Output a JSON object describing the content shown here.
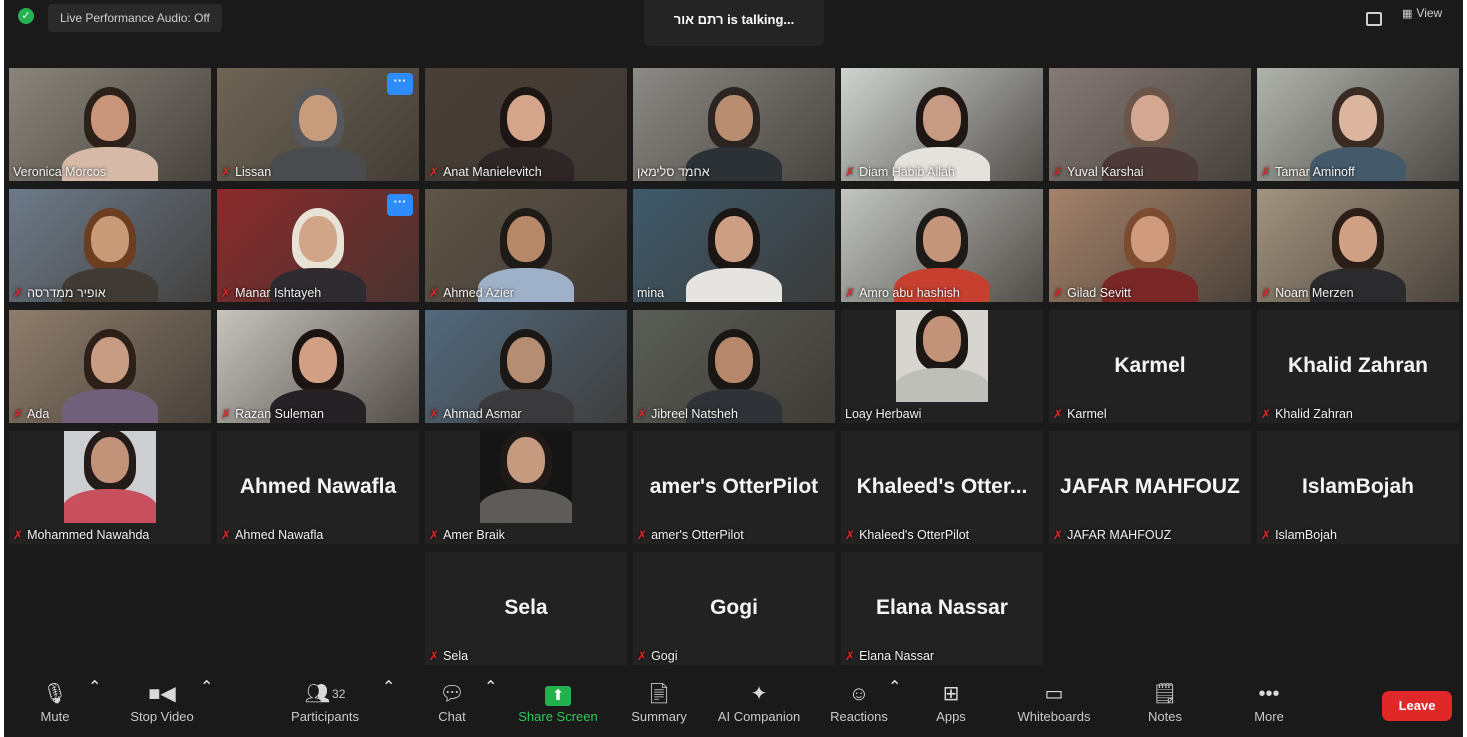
{
  "top_bar": {
    "audio_status": "Live Performance Audio: Off",
    "talking_banner": "רתם אור is talking...",
    "view_label": "View"
  },
  "participant_tiles": [
    {
      "name": "Veronica Morcos",
      "muted": false,
      "video": true,
      "bg": "#8a857c",
      "skin": "#c9957a",
      "hair": "#2b2119",
      "shirt": "#d7b9a8"
    },
    {
      "name": "Lissan",
      "muted": true,
      "video": true,
      "more": true,
      "bg": "#6e6556",
      "skin": "#c69c7d",
      "hair": "#56575a",
      "shirt": "#4a4b4f"
    },
    {
      "name": "Anat Manielevitch",
      "muted": true,
      "video": true,
      "bg": "#4a3f38",
      "skin": "#d4a48b",
      "hair": "#1c1513",
      "shirt": "#2d2526"
    },
    {
      "name": "אחמד סלימאן",
      "muted": false,
      "video": true,
      "bg": "#8c8a86",
      "skin": "#b98e70",
      "hair": "#2c2420",
      "shirt": "#2c3136"
    },
    {
      "name": "Diam Habib Allah",
      "muted": true,
      "video": true,
      "bg": "#cfd3d0",
      "skin": "#c79b83",
      "hair": "#1f1714",
      "shirt": "#e4e2dc"
    },
    {
      "name": "Yuval Karshai",
      "muted": true,
      "video": true,
      "bg": "#857a75",
      "skin": "#d3a791",
      "hair": "#6a5548",
      "shirt": "#4c3a38"
    },
    {
      "name": "Tamar Aminoff",
      "muted": true,
      "video": true,
      "bg": "#b0b3ac",
      "skin": "#dcb59f",
      "hair": "#3a2b22",
      "shirt": "#445a6a"
    },
    {
      "name": "אופיר ממדרסה",
      "muted": true,
      "video": true,
      "bg": "#6d7a89",
      "skin": "#c99a78",
      "hair": "#6b3d21",
      "shirt": "#3f3a34"
    },
    {
      "name": "Manar Ishtayeh",
      "muted": true,
      "video": true,
      "more": true,
      "bg": "#8c2a2c",
      "skin": "#d1a587",
      "hair": "#e7e1d6",
      "shirt": "#2d2b2f"
    },
    {
      "name": "Ahmed Azier",
      "muted": true,
      "video": true,
      "bg": "#5f5548",
      "skin": "#b78868",
      "hair": "#1d1a17",
      "shirt": "#9fb1c8"
    },
    {
      "name": "mina",
      "muted": false,
      "video": true,
      "bg": "#3f5a6b",
      "skin": "#cc9e84",
      "hair": "#1b1513",
      "shirt": "#e6e4e1"
    },
    {
      "name": "Amro abu hashish",
      "muted": true,
      "video": true,
      "bg": "#c2c5c1",
      "skin": "#c4957a",
      "hair": "#1e1a18",
      "shirt": "#c7402f"
    },
    {
      "name": "Gilad Sevitt",
      "muted": true,
      "video": true,
      "bg": "#a4826a",
      "skin": "#d09a7f",
      "hair": "#7b4c30",
      "shirt": "#7a2727"
    },
    {
      "name": "Noam Merzen",
      "muted": true,
      "video": true,
      "bg": "#a1937f",
      "skin": "#cfa083",
      "hair": "#2a1e17",
      "shirt": "#2b2a2c"
    },
    {
      "name": "Ada",
      "muted": true,
      "video": true,
      "bg": "#8e7d6c",
      "skin": "#c79c82",
      "hair": "#2d2019",
      "shirt": "#70607a"
    },
    {
      "name": "Razan Suleman",
      "muted": true,
      "video": true,
      "bg": "#c7c3bd",
      "skin": "#d1a084",
      "hair": "#1b1412",
      "shirt": "#262124"
    },
    {
      "name": "Ahmad Asmar",
      "muted": true,
      "video": true,
      "bg": "#52697d",
      "skin": "#b58d72",
      "hair": "#1b1715",
      "shirt": "#3a3a3c"
    },
    {
      "name": "Jibreel Natsheh",
      "muted": true,
      "video": true,
      "bg": "#5a5d57",
      "skin": "#b5876b",
      "hair": "#1a1614",
      "shirt": "#2f3236"
    },
    {
      "name": "Loay Herbawi",
      "muted": false,
      "video": true,
      "inset": true,
      "bg": "#d7d5cf",
      "skin": "#c29378",
      "hair": "#1c1714",
      "shirt": "#bfbfb9"
    },
    {
      "name": "Karmel",
      "muted": true,
      "video": false
    },
    {
      "name": "Khalid Zahran",
      "muted": true,
      "video": false
    },
    {
      "name": "Mohammed Nawahda",
      "muted": true,
      "video": true,
      "inset": true,
      "bg": "#cdced2",
      "skin": "#c29378",
      "hair": "#231c18",
      "shirt": "#c8505e"
    },
    {
      "name": "Ahmed Nawafla",
      "muted": true,
      "video": false
    },
    {
      "name": "Amer Braik",
      "muted": true,
      "video": true,
      "inset": true,
      "bg": "#151515",
      "skin": "#c69a7f",
      "hair": "#1f1a17",
      "shirt": "#5e5c58"
    },
    {
      "name": "amer's OtterPilot",
      "muted": true,
      "video": false
    },
    {
      "name": "Khaleed's OtterPilot",
      "display": "Khaleed's  Otter...",
      "muted": true,
      "video": false
    },
    {
      "name": "JAFAR MAHFOUZ",
      "muted": true,
      "video": false
    },
    {
      "name": "IslamBojah",
      "muted": true,
      "video": false
    },
    {
      "name": "Sela",
      "muted": true,
      "video": false
    },
    {
      "name": "Gogi",
      "muted": true,
      "video": false
    },
    {
      "name": "Elana Nassar",
      "muted": true,
      "video": false
    }
  ],
  "toolbar": {
    "mute": "Mute",
    "stop_video": "Stop Video",
    "participants": "Participants",
    "participants_count": "32",
    "chat": "Chat",
    "share_screen": "Share Screen",
    "summary": "Summary",
    "ai_companion": "AI Companion",
    "reactions": "Reactions",
    "apps": "Apps",
    "whiteboards": "Whiteboards",
    "notes": "Notes",
    "more": "More",
    "leave": "Leave"
  },
  "colors": {
    "app_bg": "#1a1a1a",
    "tile_bg": "#222222",
    "share_green": "#23b14d",
    "leave_red": "#e02828",
    "mute_red": "#e02828",
    "accent_blue": "#2d8cff"
  }
}
